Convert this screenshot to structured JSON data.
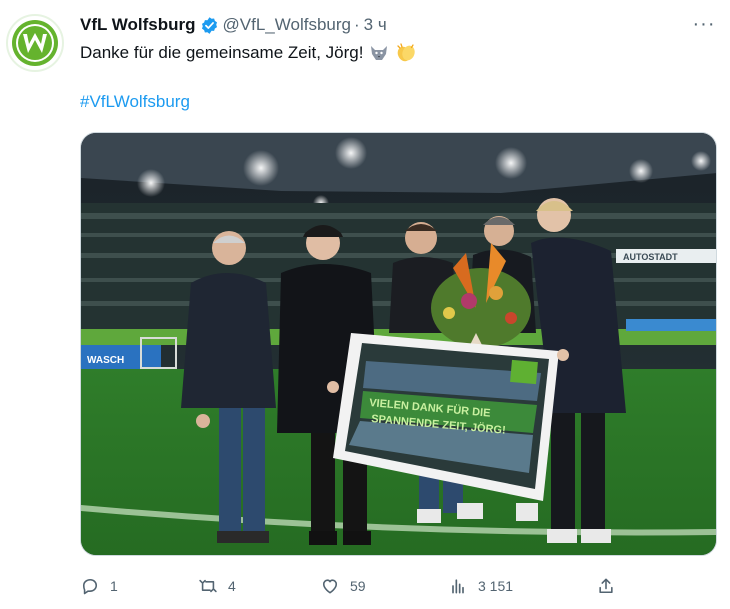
{
  "tweet": {
    "author_name": "VfL Wolfsburg",
    "author_handle": "@VfL_Wolfsburg",
    "separator": "·",
    "time": "3 ч",
    "text": "Danke für die gemeinsame Zeit, Jörg!",
    "hashtag": "#VfLWolfsburg",
    "emojis": [
      "wolf-icon",
      "clapping-hands-icon"
    ]
  },
  "media": {
    "stadium_banner": "AUTOSTADT",
    "frame_text_1": "VIELEN DANK FÜR DIE",
    "frame_text_2": "SPANNENDE ZEIT, JÖRG!",
    "ad_left": "WASCH"
  },
  "actions": {
    "replies": "1",
    "reposts": "4",
    "likes": "59",
    "views": "3 151"
  },
  "colors": {
    "brand_green": "#65b32e",
    "link_blue": "#1d9bf0",
    "muted": "#536471"
  }
}
